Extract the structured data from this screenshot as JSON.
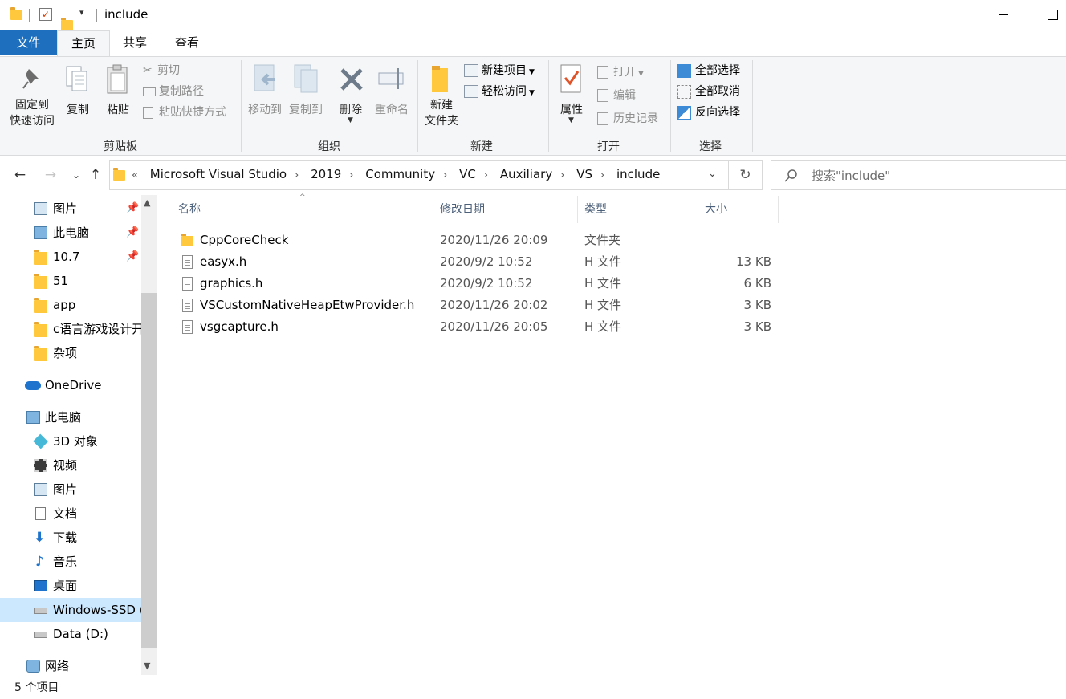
{
  "window": {
    "title": "include",
    "close_glyph": "✕",
    "maximize_glyph": "☐"
  },
  "tabs": [
    {
      "label": "文件"
    },
    {
      "label": "主页"
    },
    {
      "label": "共享"
    },
    {
      "label": "查看"
    }
  ],
  "ribbon": {
    "clipboard": {
      "pin_label_1": "固定到",
      "pin_label_2": "快速访问",
      "copy": "复制",
      "paste": "粘贴",
      "cut": "剪切",
      "copy_path": "复制路径",
      "paste_shortcut": "粘贴快捷方式",
      "group": "剪贴板"
    },
    "organize": {
      "move_to": "移动到",
      "copy_to": "复制到",
      "delete": "删除",
      "rename": "重命名",
      "group": "组织"
    },
    "new": {
      "new_folder_1": "新建",
      "new_folder_2": "文件夹",
      "new_item": "新建项目",
      "easy_access": "轻松访问",
      "group": "新建"
    },
    "open": {
      "properties": "属性",
      "open": "打开",
      "edit": "编辑",
      "history": "历史记录",
      "group": "打开"
    },
    "select": {
      "select_all": "全部选择",
      "select_none": "全部取消",
      "invert": "反向选择",
      "group": "选择"
    }
  },
  "address": {
    "prefix": "«",
    "crumbs": [
      "Microsoft Visual Studio",
      "2019",
      "Community",
      "VC",
      "Auxiliary",
      "VS",
      "include"
    ],
    "search_placeholder": "搜索\"include\""
  },
  "nav": [
    {
      "label": "图片",
      "icon": "pictures-icon",
      "pinned": true
    },
    {
      "label": "此电脑",
      "icon": "pc-icon",
      "pinned": true
    },
    {
      "label": "10.7",
      "icon": "folder-icon",
      "pinned": true
    },
    {
      "label": "51",
      "icon": "folder-icon",
      "pinned": false
    },
    {
      "label": "app",
      "icon": "folder-icon",
      "pinned": false
    },
    {
      "label": "c语言游戏设计开",
      "icon": "folder-icon",
      "pinned": false
    },
    {
      "label": "杂项",
      "icon": "folder-icon",
      "pinned": false
    },
    {
      "label": "OneDrive",
      "icon": "onedrive-icon",
      "pinned": false
    },
    {
      "label": "此电脑",
      "icon": "pc-icon",
      "pinned": false
    },
    {
      "label": "3D 对象",
      "icon": "3d-objects-icon",
      "pinned": false
    },
    {
      "label": "视频",
      "icon": "videos-icon",
      "pinned": false
    },
    {
      "label": "图片",
      "icon": "pictures-icon",
      "pinned": false
    },
    {
      "label": "文档",
      "icon": "documents-icon",
      "pinned": false
    },
    {
      "label": "下载",
      "icon": "downloads-icon",
      "pinned": false
    },
    {
      "label": "音乐",
      "icon": "music-icon",
      "pinned": false
    },
    {
      "label": "桌面",
      "icon": "desktop-icon",
      "pinned": false
    },
    {
      "label": "Windows-SSD (",
      "icon": "drive-c-icon",
      "pinned": false,
      "selected": true
    },
    {
      "label": "Data (D:)",
      "icon": "drive-d-icon",
      "pinned": false
    },
    {
      "label": "网络",
      "icon": "network-icon",
      "pinned": false
    }
  ],
  "columns": {
    "name": "名称",
    "date": "修改日期",
    "type": "类型",
    "size": "大小"
  },
  "files": [
    {
      "name": "CppCoreCheck",
      "date": "2020/11/26 20:09",
      "type": "文件夹",
      "size": "",
      "kind": "folder"
    },
    {
      "name": "easyx.h",
      "date": "2020/9/2 10:52",
      "type": "H 文件",
      "size": "13 KB",
      "kind": "file"
    },
    {
      "name": "graphics.h",
      "date": "2020/9/2 10:52",
      "type": "H 文件",
      "size": "6 KB",
      "kind": "file"
    },
    {
      "name": "VSCustomNativeHeapEtwProvider.h",
      "date": "2020/11/26 20:02",
      "type": "H 文件",
      "size": "3 KB",
      "kind": "file"
    },
    {
      "name": "vsgcapture.h",
      "date": "2020/11/26 20:05",
      "type": "H 文件",
      "size": "3 KB",
      "kind": "file"
    }
  ],
  "status": {
    "count": "5 个项目"
  }
}
